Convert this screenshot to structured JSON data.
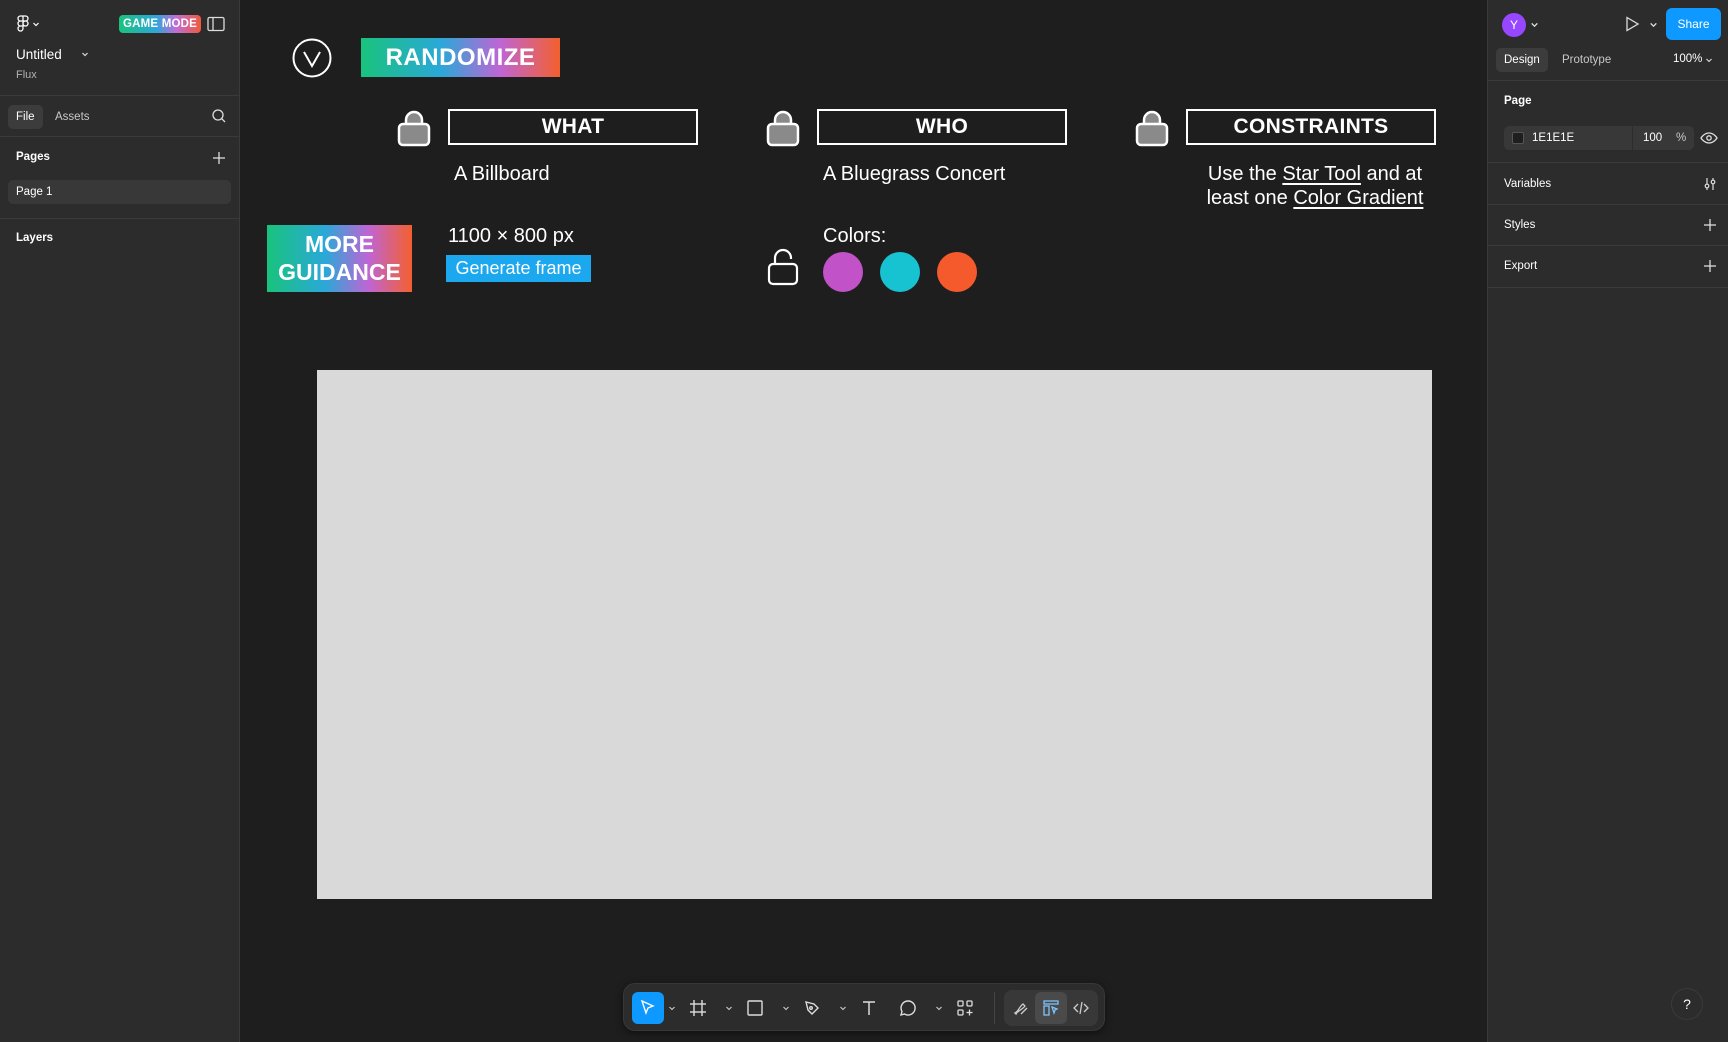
{
  "app": {
    "mode_badge": "GAME MODE",
    "file_title": "Untitled",
    "file_subtitle": "Flux"
  },
  "left_panel": {
    "tabs": [
      {
        "label": "File",
        "active": true
      },
      {
        "label": "Assets",
        "active": false
      }
    ],
    "pages_label": "Pages",
    "pages": [
      {
        "label": "Page 1",
        "selected": true
      }
    ],
    "layers_label": "Layers"
  },
  "canvas": {
    "randomize_label": "RANDOMIZE",
    "slots": [
      {
        "label": "WHAT",
        "value": "A Billboard",
        "locked": true
      },
      {
        "label": "WHO",
        "value": "A Bluegrass Concert",
        "locked": true
      },
      {
        "label": "CONSTRAINTS",
        "locked": true,
        "value_parts": [
          "Use the ",
          "Star Tool",
          " and at least one ",
          "Color Gradient"
        ]
      }
    ],
    "more_guidance_line1": "MORE",
    "more_guidance_line2": "GUIDANCE",
    "dimensions": "1100 × 800 px",
    "generate_frame_label": "Generate frame",
    "colors_label": "Colors:",
    "colors_locked": false,
    "colors": [
      "#c152c8",
      "#17c3d0",
      "#f55a2c"
    ]
  },
  "toolbar": {
    "tools": [
      "move-tool",
      "frame-tool",
      "shape-tool",
      "pen-tool",
      "text-tool",
      "comment-tool",
      "actions-tool"
    ],
    "active_tool": "move-tool",
    "mode_switch": [
      "draw-mode",
      "design-mode",
      "dev-mode"
    ],
    "active_mode": "design-mode"
  },
  "right_panel": {
    "avatar_initial": "Y",
    "share_label": "Share",
    "tabs": [
      {
        "label": "Design",
        "active": true
      },
      {
        "label": "Prototype",
        "active": false
      }
    ],
    "zoom": "100%",
    "page_section": {
      "title": "Page",
      "background_hex": "1E1E1E",
      "opacity": "100",
      "opacity_unit": "%"
    },
    "variables_label": "Variables",
    "styles_label": "Styles",
    "export_label": "Export"
  },
  "help_label": "?"
}
